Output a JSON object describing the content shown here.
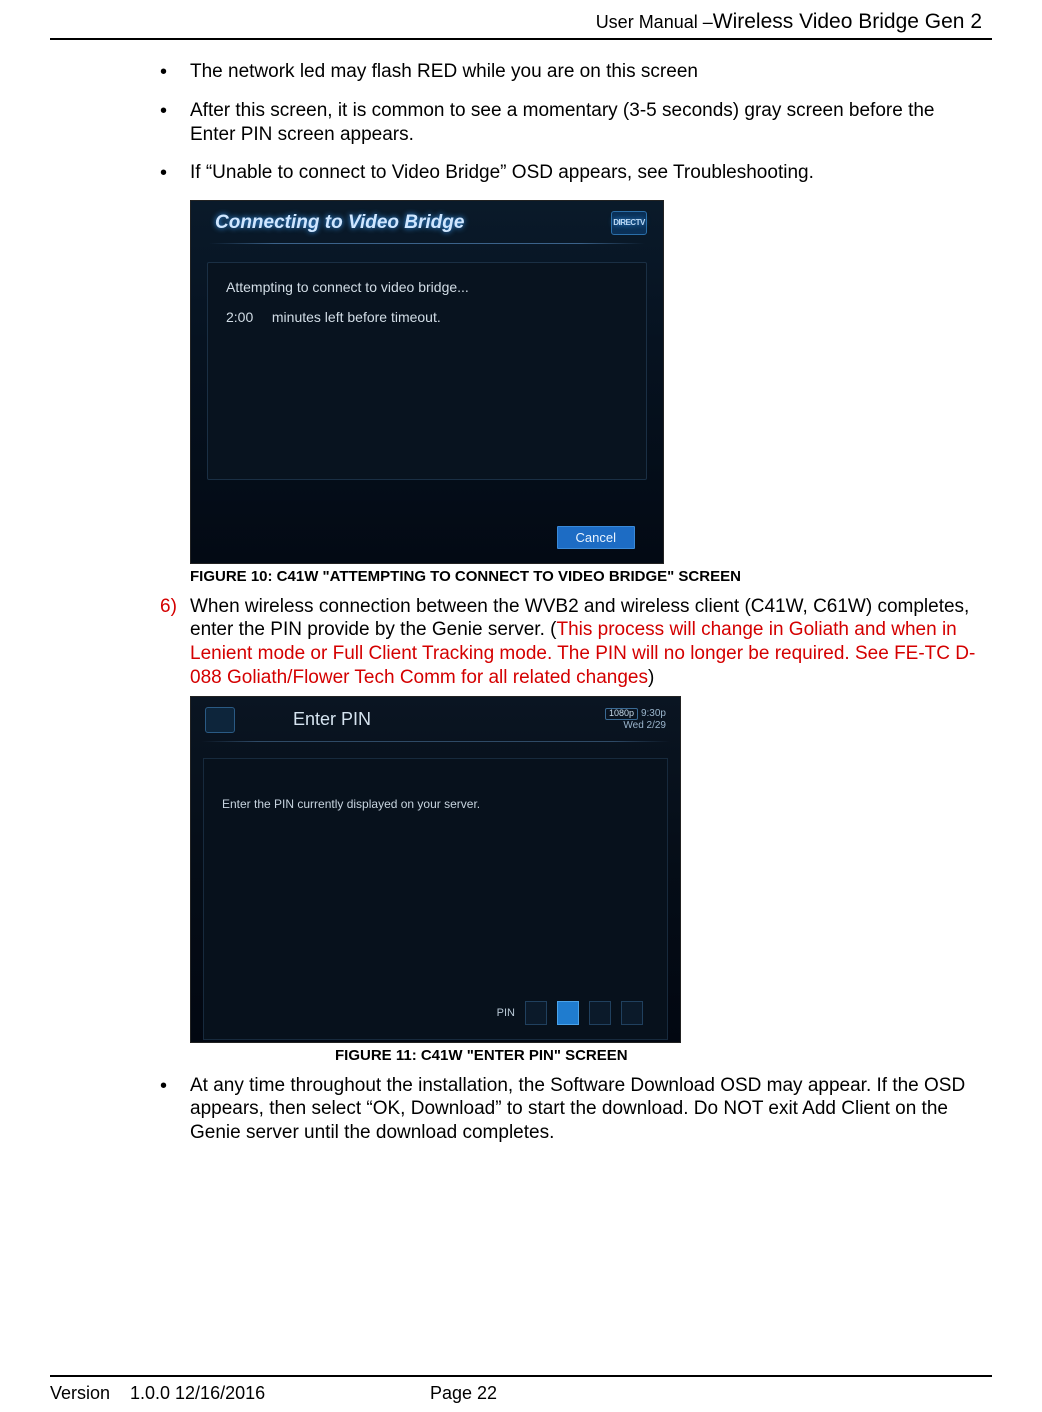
{
  "header": {
    "prefix": "User Manual –",
    "suffix": "Wireless Video Bridge Gen 2"
  },
  "bullets_top": [
    "The network led may flash RED while you are on this screen",
    "After this screen, it is common to see a momentary (3-5 seconds) gray screen before the Enter PIN screen appears.",
    "If “Unable to connect to Video Bridge” OSD appears, see Troubleshooting."
  ],
  "fig1": {
    "title": "Connecting to Video Bridge",
    "logo": "DIRECTV",
    "line1": "Attempting to connect to video bridge...",
    "time": "2:00",
    "line2_rest": "minutes left before timeout.",
    "cancel": "Cancel",
    "caption": "FIGURE 10:  C41W \"ATTEMPTING TO CONNECT TO VIDEO BRIDGE\" SCREEN"
  },
  "step6": {
    "num": "6)",
    "text_black": "When wireless connection between the WVB2 and wireless client (C41W, C61W) completes, enter the PIN provide by the Genie server.  (",
    "text_red": "This process will change in Goliath and when in Lenient mode or Full Client Tracking mode. The PIN will no longer be required. See FE-TC D-088 Goliath/Flower Tech Comm for all related changes",
    "text_black2": ")"
  },
  "fig2": {
    "title": "Enter PIN",
    "res": "1080p",
    "clock_time": "9:30p",
    "clock_date": "Wed 2/29",
    "prompt": "Enter the PIN currently displayed on your server.",
    "pin_label": "PIN",
    "caption": "FIGURE 11:  C41W \"ENTER PIN\" SCREEN"
  },
  "bullets_bottom": [
    "At any time throughout the installation, the Software Download OSD may appear. If the OSD appears, then select “OK, Download” to start the download.  Do NOT exit Add Client on the Genie server until the download completes."
  ],
  "footer": {
    "version_label": "Version",
    "version_value": "1.0.0 12/16/2016",
    "page": "Page 22"
  }
}
